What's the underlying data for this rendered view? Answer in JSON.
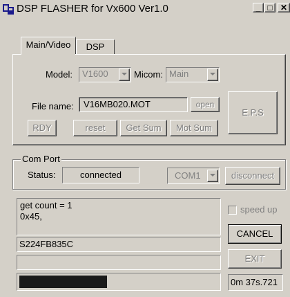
{
  "window": {
    "title": "DSP FLASHER for Vx600   Ver1.0",
    "minimize_glyph": "_",
    "maximize_glyph": "□",
    "close_glyph": "✕"
  },
  "tabs": [
    {
      "label": "Main/Video",
      "active": true
    },
    {
      "label": "DSP",
      "active": false
    }
  ],
  "main": {
    "model_label": "Model:",
    "model_value": "V1600",
    "micom_label": "Micom:",
    "micom_value": "Main",
    "file_label": "File name:",
    "file_value": "V16MB020.MOT",
    "open_label": "open",
    "eps_label": "E.P.S",
    "rdy_label": "RDY",
    "reset_label": "reset",
    "getsum_label": "Get Sum",
    "motsum_label": "Mot Sum"
  },
  "com_port": {
    "group_label": "Com Port",
    "status_label": "Status:",
    "status_value": "connected",
    "port_value": "COM1",
    "disconnect_label": "disconnect"
  },
  "log": {
    "line1": "get count = 1",
    "line2": "0x45,"
  },
  "checksum_value": "S224FB835C",
  "blank_field_value": "",
  "progress_fraction": 0.44,
  "side": {
    "speedup_label": "speed up",
    "cancel_label": "CANCEL",
    "exit_label": "EXIT",
    "timer_value": "0m 37s.721"
  },
  "colors": {
    "face": "#d4d0c8",
    "progress_fill": "#1a1a1a",
    "disabled_text": "#808080"
  }
}
